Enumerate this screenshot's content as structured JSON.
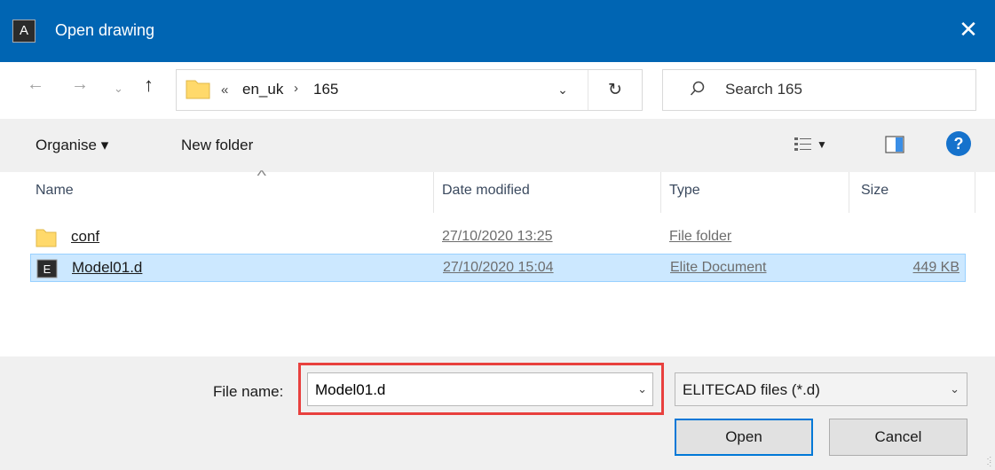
{
  "window": {
    "title": "Open drawing",
    "app_icon_letter": "A",
    "close_glyph": "✕"
  },
  "nav": {
    "back_glyph": "←",
    "forward_glyph": "→",
    "recent_glyph": "⌄",
    "up_glyph": "↑",
    "address": {
      "overflow": "«",
      "crumbs": [
        "en_uk",
        "165"
      ],
      "separator": "›",
      "dropdown_glyph": "⌄",
      "refresh_glyph": "↻"
    },
    "search_placeholder": "Search 165"
  },
  "toolbar": {
    "organise_label": "Organise ▾",
    "new_folder_label": "New folder",
    "view_drop": "▼",
    "help_glyph": "?"
  },
  "columns": {
    "name": "Name",
    "date": "Date modified",
    "type": "Type",
    "size": "Size",
    "sort_indicator": "^"
  },
  "files": [
    {
      "name": "conf",
      "date": "27/10/2020 13:25",
      "type": "File folder",
      "size": "",
      "icon": "folder-icon"
    },
    {
      "name": "Model01.d",
      "date": "27/10/2020 15:04",
      "type": "Elite Document",
      "size": "449 KB",
      "icon": "elitecad-file-icon",
      "file_icon_letter": "E"
    }
  ],
  "footer": {
    "file_name_label": "File name:",
    "file_name_value": "Model01.d",
    "file_type_value": "ELITECAD files (*.d)",
    "open_label": "Open",
    "cancel_label": "Cancel",
    "dropdown_glyph": "⌄"
  },
  "colors": {
    "titlebar": "#0065b3",
    "selection": "#cce8ff",
    "highlight": "#e8403e",
    "folder": "#ffd96b"
  }
}
